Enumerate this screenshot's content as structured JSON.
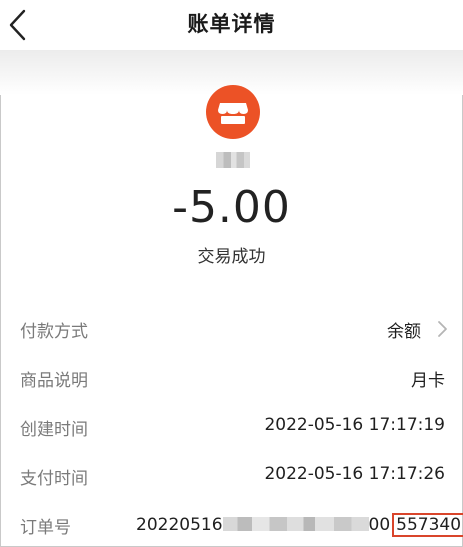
{
  "header": {
    "title": "账单详情",
    "back_icon": "chevron-left-icon"
  },
  "merchant": {
    "icon": "shop-icon",
    "icon_color": "#ec5226"
  },
  "amount": "-5.00",
  "status": "交易成功",
  "details": {
    "payment_method": {
      "label": "付款方式",
      "value": "余额"
    },
    "product_desc": {
      "label": "商品说明",
      "value": "月卡"
    },
    "created_time": {
      "label": "创建时间",
      "value": "2022-05-16 17:17:19"
    },
    "paid_time": {
      "label": "支付时间",
      "value": "2022-05-16 17:17:26"
    },
    "order_no": {
      "label": "订单号",
      "prefix": "20220516",
      "mid": "00",
      "suffix": "557340"
    }
  }
}
